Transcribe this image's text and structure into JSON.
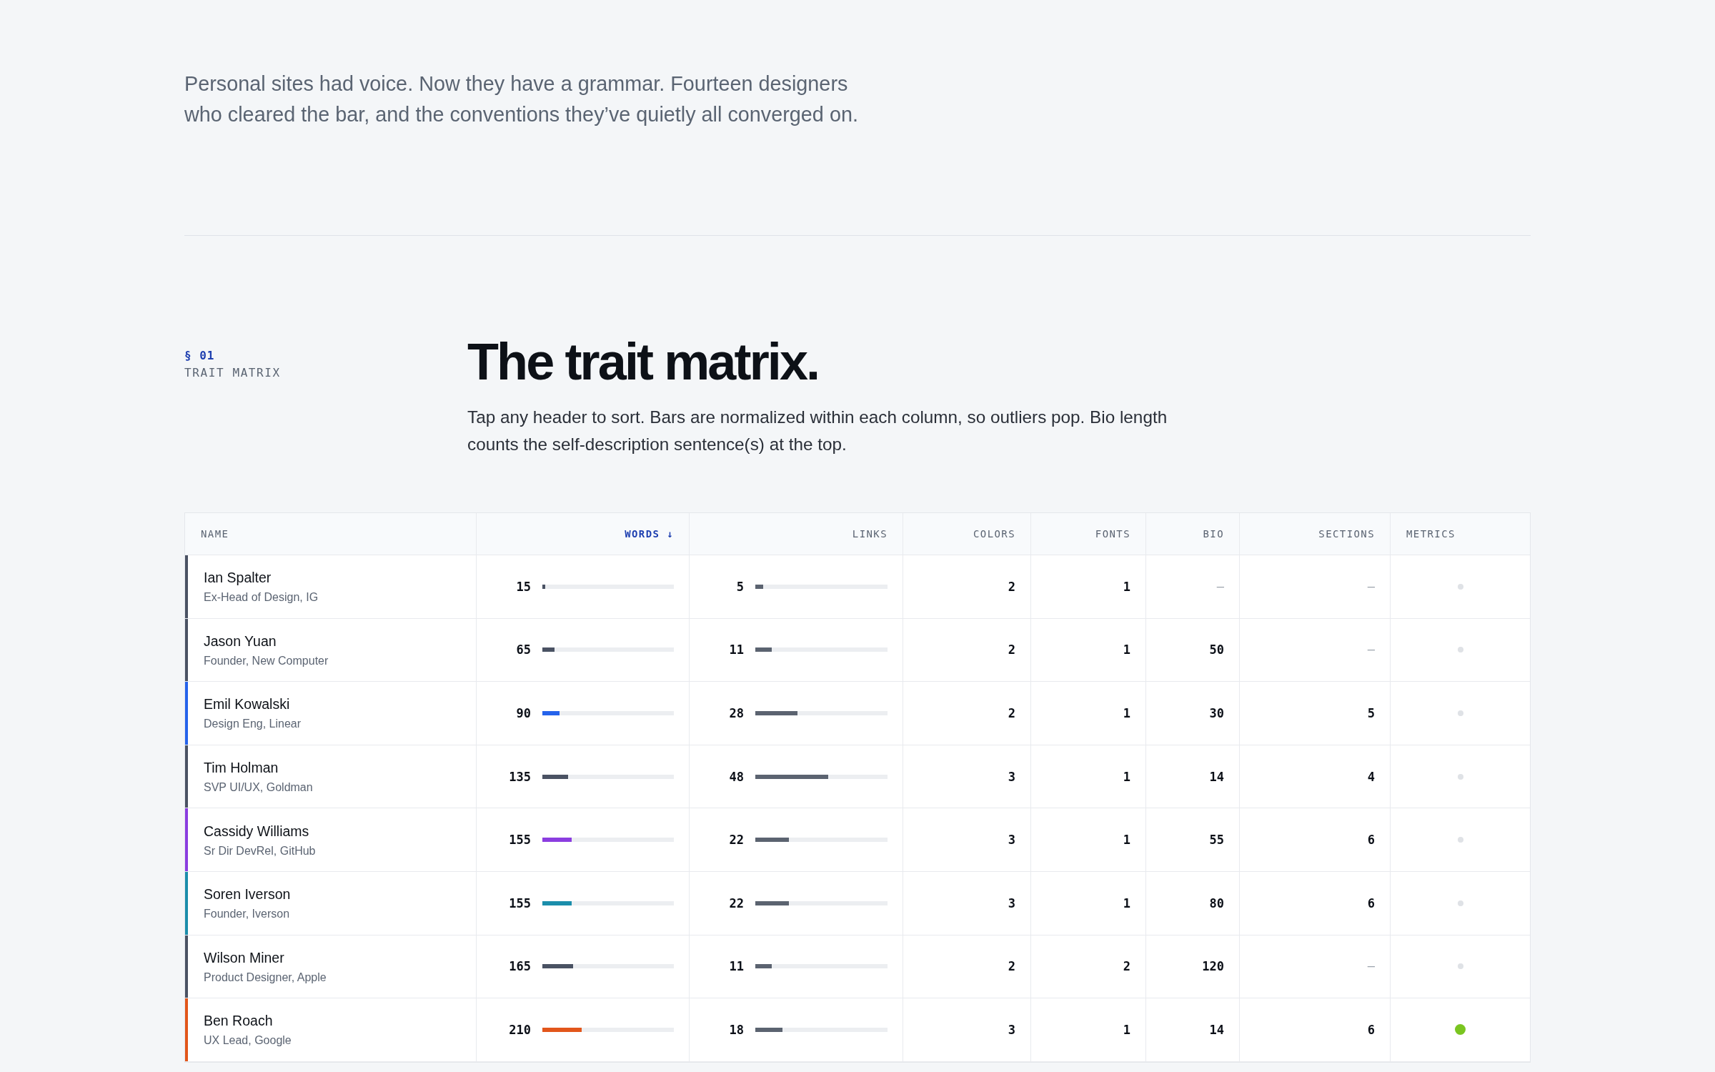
{
  "hero": {
    "intro_lines": [
      "Personal sites had voice. Now they have a grammar. Fourteen designers",
      "who cleared the bar, and the conventions they’ve quietly all converged on."
    ]
  },
  "section": {
    "number": "§ 01",
    "label": "TRAIT MATRIX",
    "heading": "The trait matrix.",
    "description_lines": [
      "Tap any header to sort. Bars are normalized within each column, so outliers pop. Bio length",
      "counts the self-description sentence(s) at the top."
    ]
  },
  "table": {
    "columns": [
      {
        "label": "NAME",
        "kind": "text",
        "sorted": false
      },
      {
        "label": "WORDS",
        "kind": "bar",
        "sorted": true,
        "arrow": "↓"
      },
      {
        "label": "LINKS",
        "kind": "bar",
        "sorted": false
      },
      {
        "label": "COLORS",
        "kind": "number",
        "sorted": false
      },
      {
        "label": "FONTS",
        "kind": "number",
        "sorted": false
      },
      {
        "label": "BIO",
        "kind": "number",
        "sorted": false
      },
      {
        "label": "SECTIONS",
        "kind": "number",
        "sorted": false
      },
      {
        "label": "METRICS",
        "kind": "status",
        "sorted": false
      }
    ],
    "rows": [
      {
        "name": "Ian Spalter",
        "role": "Ex-Head of Design, IG",
        "color": "#4a5263",
        "words": {
          "value": "15",
          "level": 0.021
        },
        "links": {
          "value": "5",
          "level": 0.057
        },
        "colors": "2",
        "fonts": "1",
        "bio": {
          "value": "—",
          "missing": true
        },
        "sections": {
          "value": "—",
          "missing": true
        },
        "metrics": false
      },
      {
        "name": "Jason Yuan",
        "role": "Founder, New Computer",
        "color": "#4a5263",
        "words": {
          "value": "65",
          "level": 0.093
        },
        "links": {
          "value": "11",
          "level": 0.126
        },
        "colors": "2",
        "fonts": "1",
        "bio": {
          "value": "50",
          "missing": false
        },
        "sections": {
          "value": "—",
          "missing": true
        },
        "metrics": false
      },
      {
        "name": "Emil Kowalski",
        "role": "Design Eng, Linear",
        "color": "#2563eb",
        "words": {
          "value": "90",
          "level": 0.129
        },
        "links": {
          "value": "28",
          "level": 0.32
        },
        "colors": "2",
        "fonts": "1",
        "bio": {
          "value": "30",
          "missing": false
        },
        "sections": {
          "value": "5",
          "missing": false
        },
        "metrics": false
      },
      {
        "name": "Tim Holman",
        "role": "SVP UI/UX, Goldman",
        "color": "#4a5263",
        "words": {
          "value": "135",
          "level": 0.193
        },
        "links": {
          "value": "48",
          "level": 0.55
        },
        "colors": "3",
        "fonts": "1",
        "bio": {
          "value": "14",
          "missing": false
        },
        "sections": {
          "value": "4",
          "missing": false
        },
        "metrics": false
      },
      {
        "name": "Cassidy Williams",
        "role": "Sr Dir DevRel, GitHub",
        "color": "#8b3de0",
        "words": {
          "value": "155",
          "level": 0.221
        },
        "links": {
          "value": "22",
          "level": 0.253
        },
        "colors": "3",
        "fonts": "1",
        "bio": {
          "value": "55",
          "missing": false
        },
        "sections": {
          "value": "6",
          "missing": false
        },
        "metrics": false
      },
      {
        "name": "Soren Iverson",
        "role": "Founder, Iverson",
        "color": "#1b8eab",
        "words": {
          "value": "155",
          "level": 0.221
        },
        "links": {
          "value": "22",
          "level": 0.253
        },
        "colors": "3",
        "fonts": "1",
        "bio": {
          "value": "80",
          "missing": false
        },
        "sections": {
          "value": "6",
          "missing": false
        },
        "metrics": false
      },
      {
        "name": "Wilson Miner",
        "role": "Product Designer, Apple",
        "color": "#4a5263",
        "words": {
          "value": "165",
          "level": 0.236
        },
        "links": {
          "value": "11",
          "level": 0.126
        },
        "colors": "2",
        "fonts": "2",
        "bio": {
          "value": "120",
          "missing": false
        },
        "sections": {
          "value": "—",
          "missing": true
        },
        "metrics": false
      },
      {
        "name": "Ben Roach",
        "role": "UX Lead, Google",
        "color": "#e2561b",
        "words": {
          "value": "210",
          "level": 0.3
        },
        "links": {
          "value": "18",
          "level": 0.207
        },
        "colors": "3",
        "fonts": "1",
        "bio": {
          "value": "14",
          "missing": false
        },
        "sections": {
          "value": "6",
          "missing": false
        },
        "metrics": true
      }
    ]
  }
}
